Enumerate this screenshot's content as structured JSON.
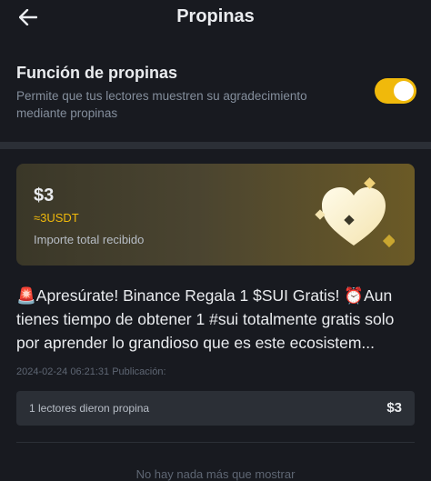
{
  "header": {
    "title": "Propinas",
    "back_icon": "arrow-left-icon"
  },
  "tip_setting": {
    "title": "Función de propinas",
    "description": "Permite que tus lectores muestren su agradecimiento mediante propinas",
    "enabled": true,
    "toggle_color": "#f0b90b"
  },
  "summary_card": {
    "amount": "$3",
    "usdt": "≈3USDT",
    "label": "Importe total recibido",
    "icon": "heart-icon"
  },
  "post": {
    "text": "🚨Apresúrate! Binance Regala 1 $SUI Gratis! ⏰Aun tienes tiempo de obtener 1 #sui totalmente gratis solo por aprender lo grandioso que es este ecosistem...",
    "meta": "2024-02-24 06:21:31 Publicación:"
  },
  "tippers": {
    "label": "1 lectores dieron propina",
    "amount": "$3"
  },
  "footer": {
    "text": "No hay nada más que mostrar"
  },
  "colors": {
    "background": "#181a20",
    "accent": "#f0b90b",
    "muted_text": "#848e9c"
  }
}
